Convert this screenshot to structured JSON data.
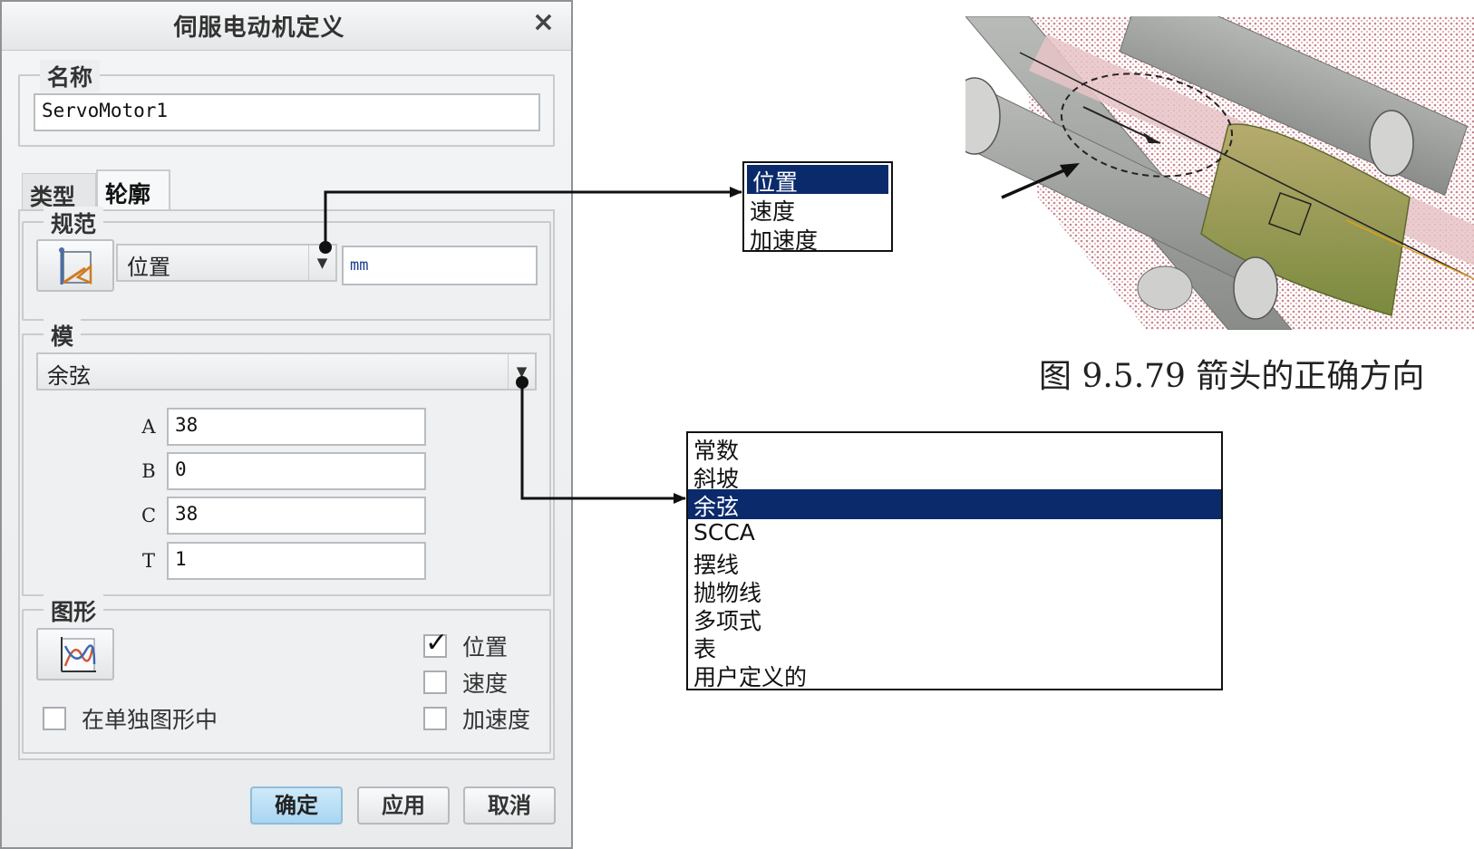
{
  "dialog": {
    "title": "伺服电动机定义",
    "close_glyph": "×",
    "name_group": {
      "legend": "名称",
      "value": "ServoMotor1"
    },
    "tabs": [
      {
        "label": "类型"
      },
      {
        "label": "轮廓"
      }
    ],
    "spec_group": {
      "legend": "规范",
      "combo_value": "位置",
      "unit": "mm"
    },
    "model_group": {
      "legend": "模",
      "combo_value": "余弦",
      "params": [
        {
          "label": "A",
          "value": "38"
        },
        {
          "label": "B",
          "value": "0"
        },
        {
          "label": "C",
          "value": "38"
        },
        {
          "label": "T",
          "value": "1"
        }
      ]
    },
    "graph_group": {
      "legend": "图形",
      "separate_graph_label": "在单独图形中",
      "options": [
        {
          "label": "位置",
          "checked": true
        },
        {
          "label": "速度",
          "checked": false
        },
        {
          "label": "加速度",
          "checked": false
        }
      ]
    },
    "buttons": {
      "ok": "确定",
      "apply": "应用",
      "cancel": "取消"
    }
  },
  "spec_dropdown": {
    "options": [
      "位置",
      "速度",
      "加速度"
    ],
    "selected": "位置"
  },
  "model_dropdown": {
    "options": [
      "常数",
      "斜坡",
      "余弦",
      "SCCA",
      "摆线",
      "抛物线",
      "多项式",
      "表",
      "用户定义的"
    ],
    "selected": "余弦"
  },
  "figure": {
    "caption": "图 9.5.79    箭头的正确方向"
  },
  "colors": {
    "selection": "#0a2a6c",
    "ok_button": "#a8d6f2",
    "model_body": "#8f9a50",
    "shaft": "#e8c4c8"
  }
}
